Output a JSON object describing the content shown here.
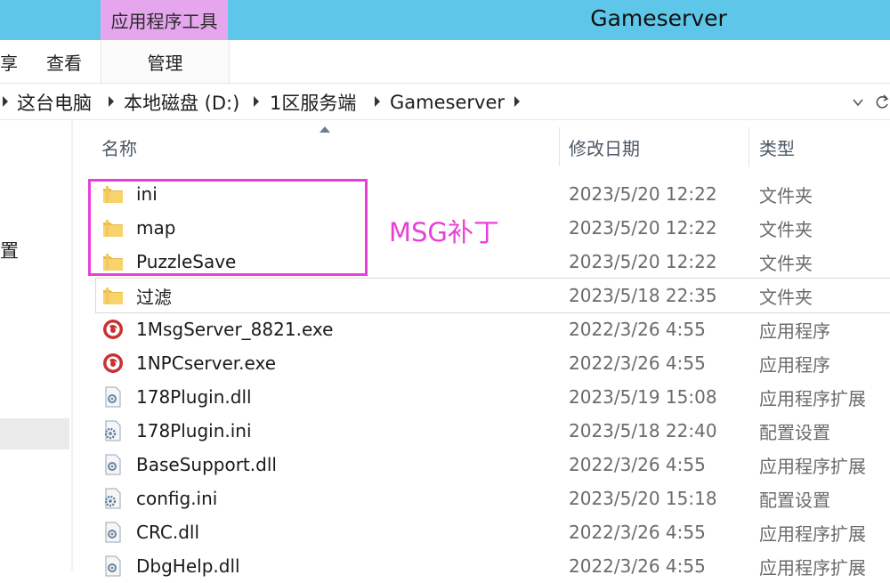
{
  "titlebar": {
    "tool_tab": "应用程序工具",
    "window_title": "Gameserver",
    "bg_color": "#5ec6e8",
    "tool_tab_color": "#e6a6ee"
  },
  "ribbon": {
    "tabs": [
      {
        "label": "享"
      },
      {
        "label": "查看"
      },
      {
        "label": "管理"
      }
    ]
  },
  "address": {
    "crumbs": [
      "这台电脑",
      "本地磁盘 (D:)",
      "1区服务端",
      "Gameserver"
    ],
    "dropdown_icon": "chevron-down-icon",
    "refresh_icon": "refresh-icon"
  },
  "nav": {
    "partial_label": "置"
  },
  "columns": {
    "name": "名称",
    "date": "修改日期",
    "type": "类型"
  },
  "files": [
    {
      "name": "ini",
      "date": "2023/5/20 12:22",
      "type": "文件夹",
      "icon": "folder-icon"
    },
    {
      "name": "map",
      "date": "2023/5/20 12:22",
      "type": "文件夹",
      "icon": "folder-icon"
    },
    {
      "name": "PuzzleSave",
      "date": "2023/5/20 12:22",
      "type": "文件夹",
      "icon": "folder-icon"
    },
    {
      "name": "过滤",
      "date": "2023/5/18 22:35",
      "type": "文件夹",
      "icon": "folder-icon"
    },
    {
      "name": "1MsgServer_8821.exe",
      "date": "2022/3/26 4:55",
      "type": "应用程序",
      "icon": "exe-icon"
    },
    {
      "name": "1NPCserver.exe",
      "date": "2022/3/26 4:55",
      "type": "应用程序",
      "icon": "exe-icon"
    },
    {
      "name": "178Plugin.dll",
      "date": "2023/5/19 15:08",
      "type": "应用程序扩展",
      "icon": "dll-icon"
    },
    {
      "name": "178Plugin.ini",
      "date": "2023/5/18 22:40",
      "type": "配置设置",
      "icon": "ini-icon"
    },
    {
      "name": "BaseSupport.dll",
      "date": "2022/3/26 4:55",
      "type": "应用程序扩展",
      "icon": "dll-icon"
    },
    {
      "name": "config.ini",
      "date": "2023/5/20 15:18",
      "type": "配置设置",
      "icon": "ini-icon"
    },
    {
      "name": "CRC.dll",
      "date": "2022/3/26 4:55",
      "type": "应用程序扩展",
      "icon": "dll-icon"
    },
    {
      "name": "DbgHelp.dll",
      "date": "2022/3/26 4:55",
      "type": "应用程序扩展",
      "icon": "dll-icon"
    }
  ],
  "annotation": {
    "text": "MSG补丁",
    "color": "#e93fd8"
  }
}
